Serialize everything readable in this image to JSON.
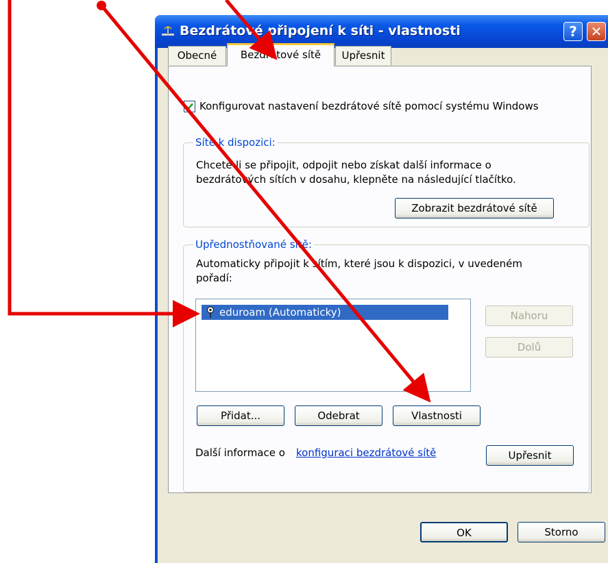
{
  "window": {
    "title": "Bezdrátové připojení k síti - vlastnosti",
    "help_button": "?",
    "close_button": "✕"
  },
  "tabs": [
    {
      "label": "Obecné",
      "active": false
    },
    {
      "label": "Bezdrátové sítě",
      "active": true
    },
    {
      "label": "Upřesnit",
      "active": false
    }
  ],
  "config_checkbox": {
    "label": "Konfigurovat nastavení bezdrátové sítě pomocí systému Windows",
    "checked": true
  },
  "available_networks": {
    "legend": "Sítě k dispozici:",
    "description_line1": "Chcete-li se připojit, odpojit nebo získat další informace o",
    "description_line2": "bezdrátových sítích v dosahu, klepněte na následující tlačítko.",
    "view_button": "Zobrazit bezdrátové sítě"
  },
  "preferred_networks": {
    "legend": "Upřednostňované sítě:",
    "description_line1": "Automaticky připojit k sítím, které jsou k dispozici, v uvedeném",
    "description_line2": "pořadí:",
    "items": [
      {
        "label": "eduroam (Automaticky)",
        "selected": true
      }
    ],
    "up_button": "Nahoru",
    "down_button": "Dolů",
    "add_button": "Přidat...",
    "remove_button": "Odebrat",
    "properties_button": "Vlastnosti"
  },
  "more_info": {
    "prefix": "Další informace o",
    "link": "konfiguraci bezdrátové sítě",
    "advanced_button": "Upřesnit"
  },
  "footer": {
    "ok_button": "OK",
    "cancel_button": "Storno"
  },
  "colors": {
    "annotation_arrow": "#e60000",
    "title_bar": "#0a58e6",
    "selection": "#316ac5",
    "active_tab_highlight": "#ffc83c"
  }
}
